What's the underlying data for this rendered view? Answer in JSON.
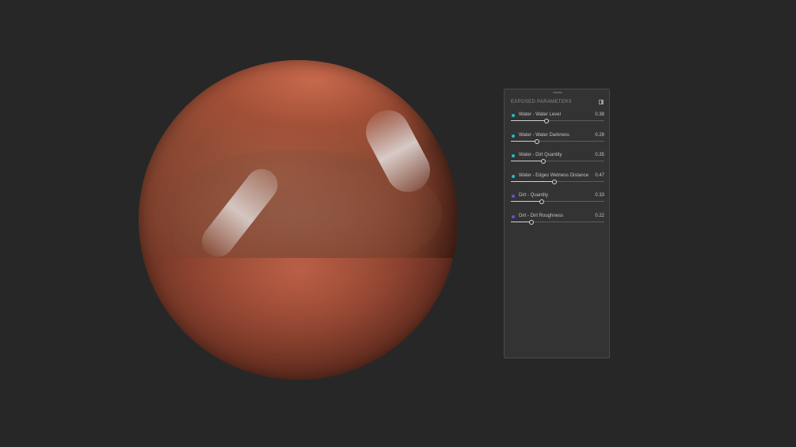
{
  "panel": {
    "title": "EXPOSED PARAMETERS",
    "collapse_icon": "panel-toggle-icon",
    "parameters": [
      {
        "label": "Water - Water Level",
        "value": "0.38",
        "fraction": 0.38,
        "color": "#2ab7c9"
      },
      {
        "label": "Water - Water Darkness",
        "value": "0.28",
        "fraction": 0.28,
        "color": "#2ab7c9"
      },
      {
        "label": "Water - Dirt Quantity",
        "value": "0.35",
        "fraction": 0.35,
        "color": "#2ab7c9"
      },
      {
        "label": "Water - Edges Wetness Distance",
        "value": "0.47",
        "fraction": 0.47,
        "color": "#2ab7c9"
      },
      {
        "label": "Dirt - Quantity",
        "value": "0.33",
        "fraction": 0.33,
        "color": "#6b4fd1"
      },
      {
        "label": "Dirt - Dirt Roughness",
        "value": "0.22",
        "fraction": 0.22,
        "color": "#6b4fd1"
      }
    ]
  },
  "viewport": {
    "background": "#272727",
    "preview_object": "material-preview-sphere"
  }
}
